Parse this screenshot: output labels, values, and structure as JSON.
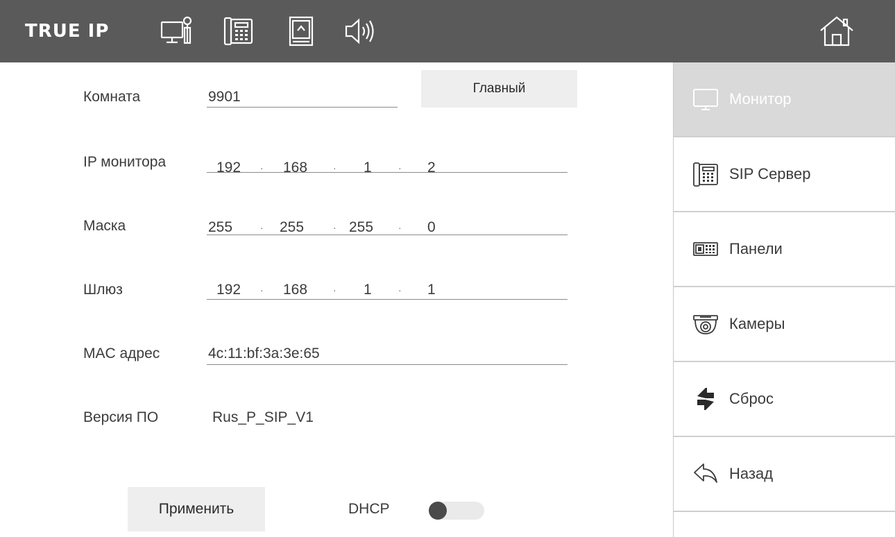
{
  "topbar": {
    "brand": "TRUE IP",
    "icons": [
      "monitor-key-icon",
      "phone-keypad-icon",
      "sd-card-icon",
      "speaker-icon",
      "home-icon"
    ]
  },
  "form": {
    "room": {
      "label": "Комната",
      "value": "9901"
    },
    "main_button": "Главный",
    "monitor_ip": {
      "label": "IP монитора",
      "octets": [
        "192",
        "168",
        "1",
        "2"
      ]
    },
    "mask": {
      "label": "Маска",
      "octets": [
        "255",
        "255",
        "255",
        "0"
      ]
    },
    "gateway": {
      "label": "Шлюз",
      "octets": [
        "192",
        "168",
        "1",
        "1"
      ]
    },
    "mac": {
      "label": "MAC адрес",
      "value": "4c:11:bf:3a:3e:65"
    },
    "firmware": {
      "label": "Версия ПО",
      "value": "Rus_P_SIP_V1"
    },
    "dot": "·",
    "apply_button": "Применить",
    "dhcp": {
      "label": "DHCP",
      "enabled": false
    }
  },
  "sidebar": {
    "items": [
      {
        "label": "Монитор",
        "icon": "monitor-icon",
        "active": true
      },
      {
        "label": "SIP Сервер",
        "icon": "phone-keypad-icon",
        "active": false
      },
      {
        "label": "Панели",
        "icon": "door-panel-icon",
        "active": false
      },
      {
        "label": "Камеры",
        "icon": "dome-camera-icon",
        "active": false
      },
      {
        "label": "Сброс",
        "icon": "reset-arrows-icon",
        "active": false
      },
      {
        "label": "Назад",
        "icon": "back-arrow-icon",
        "active": false
      }
    ]
  },
  "colors": {
    "topbar_bg": "#5a5a5a",
    "active_bg": "#d9d9d9",
    "button_bg": "#eeeeee",
    "toggle_knob": "#4a4a4a"
  }
}
